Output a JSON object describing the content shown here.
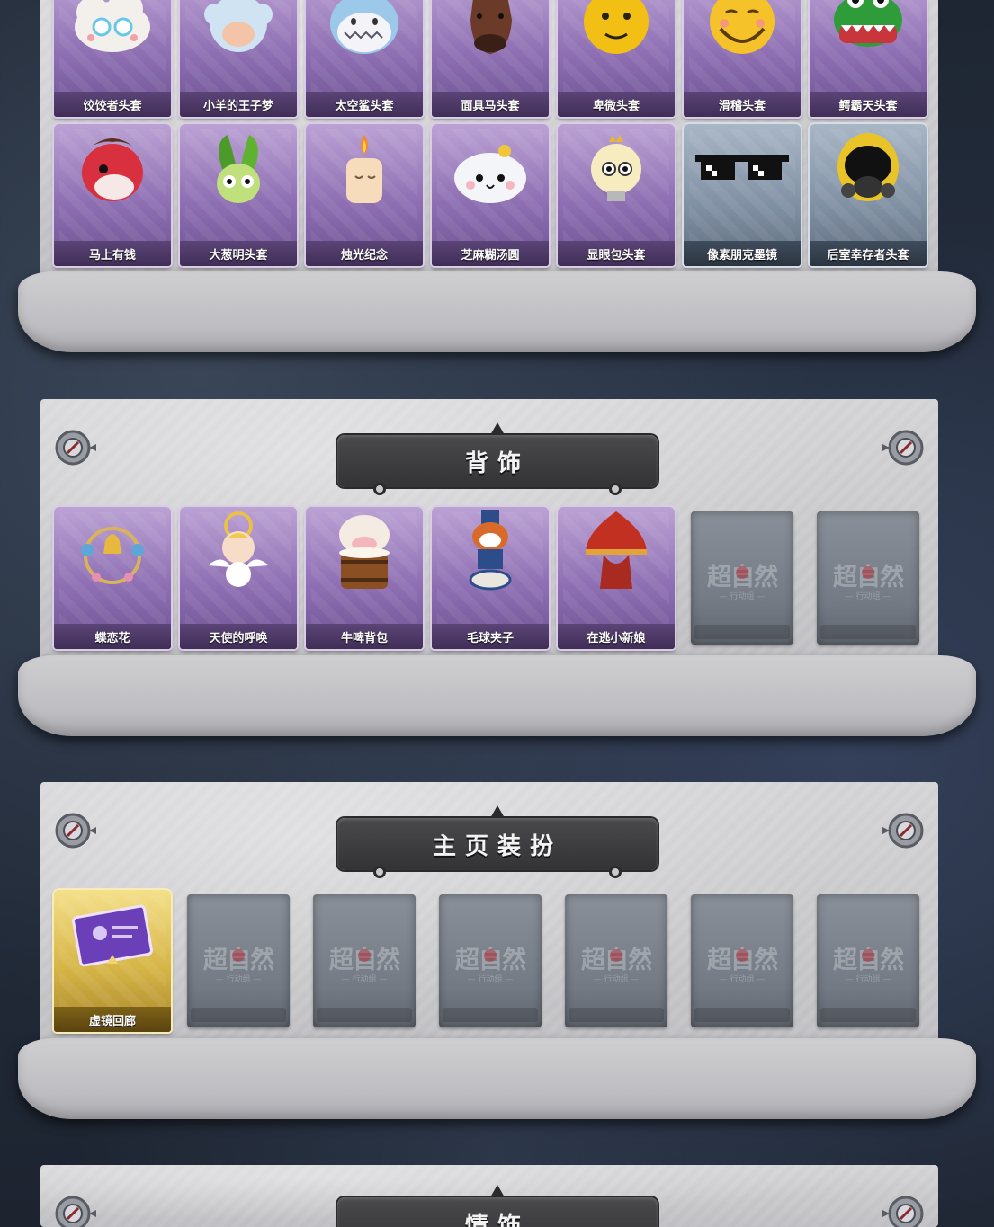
{
  "headwear": {
    "row1": [
      {
        "label": "饺饺者头套",
        "icon": "cloud-mascot-icon"
      },
      {
        "label": "小羊的王子梦",
        "icon": "sheep-crown-icon"
      },
      {
        "label": "太空鲨头套",
        "icon": "shark-head-icon"
      },
      {
        "label": "面具马头套",
        "icon": "horse-mask-icon"
      },
      {
        "label": "卑微头套",
        "icon": "yellow-face-icon"
      },
      {
        "label": "滑稽头套",
        "icon": "grin-face-icon"
      },
      {
        "label": "鳄霸天头套",
        "icon": "crocodile-head-icon"
      }
    ],
    "row2": [
      {
        "label": "马上有钱",
        "icon": "red-horse-icon"
      },
      {
        "label": "大葱明头套",
        "icon": "green-onion-icon"
      },
      {
        "label": "烛光纪念",
        "icon": "candle-icon"
      },
      {
        "label": "芝麻糊汤圆",
        "icon": "dumpling-icon"
      },
      {
        "label": "显眼包头套",
        "icon": "lightbulb-icon"
      },
      {
        "label": "像素朋克墨镜",
        "icon": "pixel-sunglasses-icon"
      },
      {
        "label": "后室幸存者头套",
        "icon": "gas-mask-helmet-icon"
      }
    ]
  },
  "back_accessories": {
    "title": "背饰",
    "items": [
      {
        "label": "蝶恋花",
        "icon": "butterfly-wreath-icon"
      },
      {
        "label": "天使的呼唤",
        "icon": "angel-icon"
      },
      {
        "label": "牛啤背包",
        "icon": "cow-barrel-icon"
      },
      {
        "label": "毛球夹子",
        "icon": "raccoon-drummer-icon"
      },
      {
        "label": "在逃小新娘",
        "icon": "red-lantern-dress-icon"
      }
    ],
    "empty_count": 2
  },
  "home_decor": {
    "title": "主页装扮",
    "items": [
      {
        "label": "虚镜回廊",
        "icon": "profile-card-icon"
      }
    ],
    "empty_count": 6
  },
  "next_section": {
    "title": "情饰"
  },
  "placeholder": {
    "watermark": "超自然",
    "sub": "— 行动组 —"
  },
  "colors": {
    "card_purple": "#8e6fb3",
    "card_gold": "#d6b547",
    "banner": "#3a3a3d",
    "panel": "#cbcbce"
  }
}
